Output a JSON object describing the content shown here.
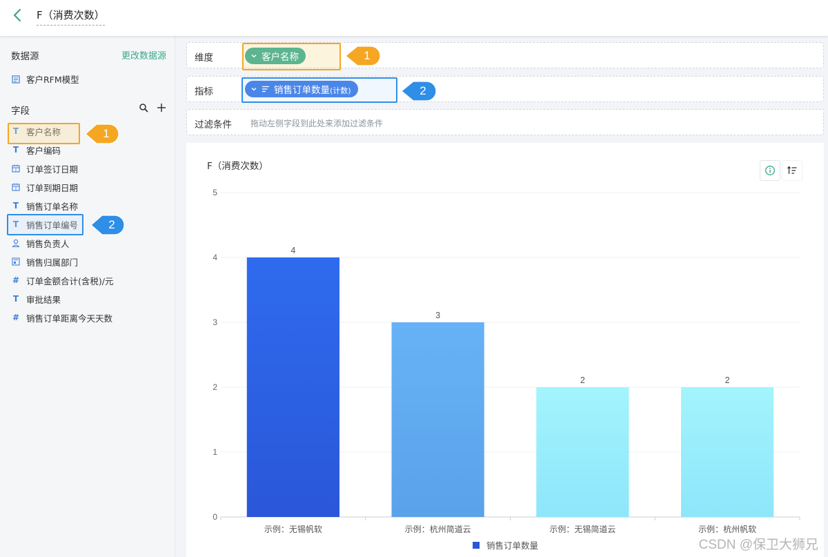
{
  "header": {
    "title": "F（消费次数）"
  },
  "sidebar": {
    "datasource_heading": "数据源",
    "change_datasource": "更改数据源",
    "datasource_name": "客户RFM模型",
    "fields_heading": "字段",
    "fields": [
      {
        "label": "客户名称",
        "icon": "text-icon",
        "glyph": "T"
      },
      {
        "label": "客户编码",
        "icon": "text-icon",
        "glyph": "T"
      },
      {
        "label": "订单签订日期",
        "icon": "date-icon",
        "glyph": "date"
      },
      {
        "label": "订单到期日期",
        "icon": "date-icon",
        "glyph": "date"
      },
      {
        "label": "销售订单名称",
        "icon": "text-icon",
        "glyph": "T"
      },
      {
        "label": "销售订单编号",
        "icon": "text-icon",
        "glyph": "T"
      },
      {
        "label": "销售负责人",
        "icon": "user-icon",
        "glyph": "user"
      },
      {
        "label": "销售归属部门",
        "icon": "department-icon",
        "glyph": "dept"
      },
      {
        "label": "订单金额合计(含税)/元",
        "icon": "number-icon",
        "glyph": "#"
      },
      {
        "label": "审批结果",
        "icon": "text-icon",
        "glyph": "T"
      },
      {
        "label": "销售订单距离今天天数",
        "icon": "number-icon",
        "glyph": "#"
      }
    ]
  },
  "dimension": {
    "label": "维度",
    "pill": "客户名称",
    "color": "#5cb58f"
  },
  "metric": {
    "label": "指标",
    "pill": "销售订单数量",
    "suffix": "(计数)",
    "color": "#4a86e8"
  },
  "filter": {
    "label": "过滤条件",
    "hint": "拖动左侧字段到此处来添加过滤条件"
  },
  "callouts": {
    "one": "1",
    "two": "2",
    "orange": "#f5a623",
    "blue": "#2f8ee6"
  },
  "chart_data": {
    "type": "bar",
    "title": "F（消费次数）",
    "categories": [
      "示例：无锡帆软",
      "示例：杭州简道云",
      "示例：无锡简道云",
      "示例：杭州帆软"
    ],
    "series": [
      {
        "name": "销售订单数量",
        "values": [
          4,
          3,
          2,
          2
        ]
      }
    ],
    "ylim": [
      0,
      5
    ],
    "yticks": [
      0,
      1,
      2,
      3,
      4,
      5
    ],
    "data_labels": true,
    "grid": true,
    "legend": "bottom-center",
    "bar_colors": [
      [
        "#2f6bef",
        "#2a57d8"
      ],
      [
        "#67b2f7",
        "#5aa2ea"
      ],
      [
        "#a3f4fd",
        "#8ee6fa"
      ],
      [
        "#a3f4fd",
        "#8ee6fa"
      ]
    ],
    "legend_color": "#2a57d8"
  },
  "watermark": "CSDN @保卫大狮兄"
}
